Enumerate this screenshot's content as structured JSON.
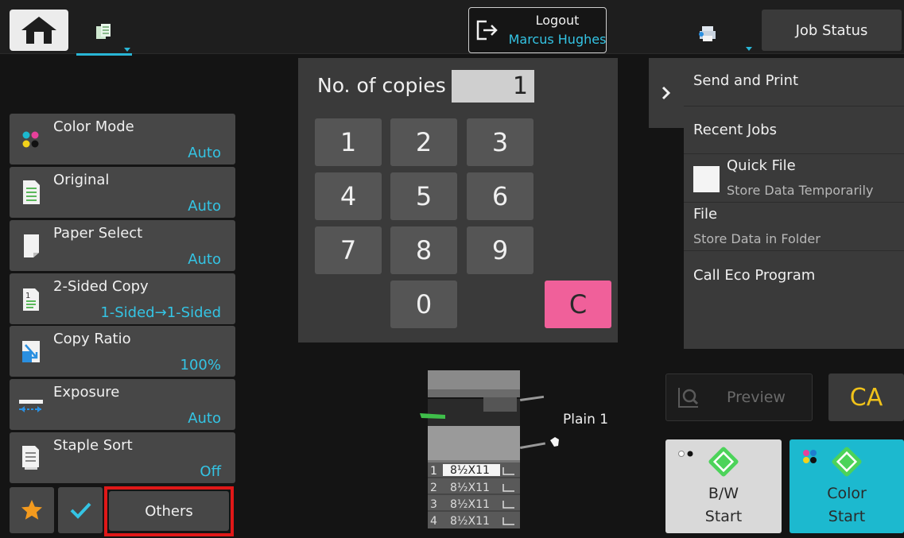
{
  "header": {
    "home_icon": "home-icon",
    "copy_tab_icon": "copy-mode-icon",
    "logout_label": "Logout",
    "logout_user": "Marcus Hughes",
    "printer_icon": "printer-status-icon",
    "job_status_label": "Job Status"
  },
  "functions": [
    {
      "title": "Color Mode",
      "value": "Auto",
      "icon": "color-mode-icon"
    },
    {
      "title": "Original",
      "value": "Auto",
      "icon": "original-icon"
    },
    {
      "title": "Paper Select",
      "value": "Auto",
      "icon": "paper-icon"
    },
    {
      "title": "2-Sided Copy",
      "value": "1-Sided→1-Sided",
      "icon": "duplex-icon"
    },
    {
      "title": "Copy Ratio",
      "value": "100%",
      "icon": "ratio-icon"
    },
    {
      "title": "Exposure",
      "value": "Auto",
      "icon": "exposure-icon"
    },
    {
      "title": "Staple Sort",
      "value": "Off",
      "icon": "staple-sort-icon"
    }
  ],
  "bottom_left": {
    "favorite_icon": "star-icon",
    "check_icon": "checkmark-icon",
    "others_label": "Others"
  },
  "keypad": {
    "copies_label": "No. of copies",
    "copies_value": "1",
    "keys": [
      "1",
      "2",
      "3",
      "4",
      "5",
      "6",
      "7",
      "8",
      "9",
      "0"
    ],
    "clear_label": "C"
  },
  "side_menu": {
    "send_and_print": "Send and Print",
    "recent_jobs": "Recent Jobs",
    "quick_file": "Quick File",
    "quick_file_sub": "Store Data Temporarily",
    "file": "File",
    "file_sub": "Store Data in Folder",
    "call_eco": "Call Eco Program"
  },
  "machine": {
    "output_label": "Plain 1",
    "trays": [
      {
        "num": "1",
        "size": "8½X11"
      },
      {
        "num": "2",
        "size": "8½X11"
      },
      {
        "num": "3",
        "size": "8½X11"
      },
      {
        "num": "4",
        "size": "8½X11"
      }
    ]
  },
  "actions": {
    "preview_label": "Preview",
    "ca_label": "CA",
    "bw_line1": "B/W",
    "bw_line2": "Start",
    "color_line1": "Color",
    "color_line2": "Start"
  },
  "colors": {
    "accent": "#34c4e4",
    "clear_key": "#f0609a",
    "ca_text": "#f0c21a",
    "color_start": "#1cb9cf",
    "highlight": "#e01818"
  }
}
